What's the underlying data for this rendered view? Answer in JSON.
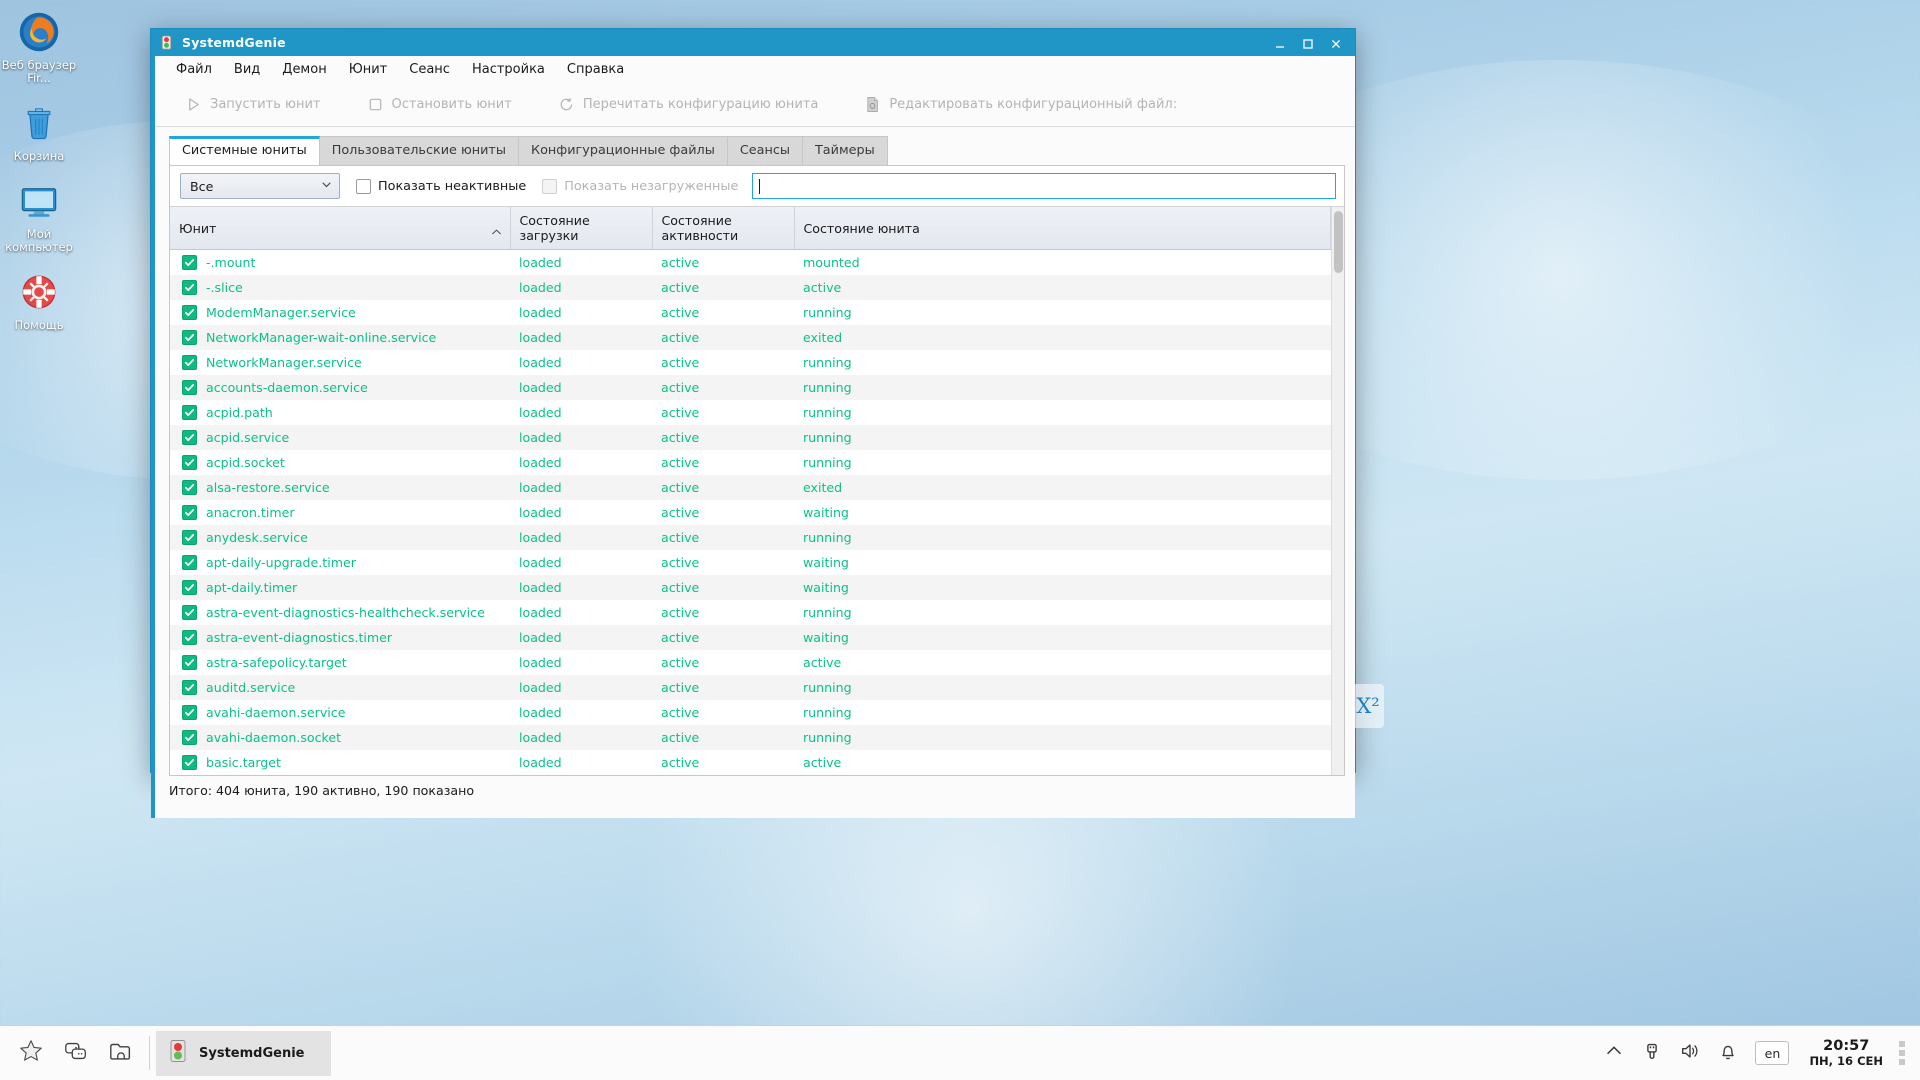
{
  "window": {
    "title": "SystemdGenie",
    "title_icon": "traffic-light-icon",
    "minimize": "minimize-button",
    "maximize": "maximize-button",
    "close": "close-button"
  },
  "menubar": {
    "items": [
      {
        "label": "Файл"
      },
      {
        "label": "Вид"
      },
      {
        "label": "Демон"
      },
      {
        "label": "Юнит"
      },
      {
        "label": "Сеанс"
      },
      {
        "label": "Настройка"
      },
      {
        "label": "Справка"
      }
    ]
  },
  "toolbar": {
    "buttons": [
      {
        "label": "Запустить юнит",
        "icon": "play-icon",
        "enabled": false
      },
      {
        "label": "Остановить юнит",
        "icon": "stop-icon",
        "enabled": false
      },
      {
        "label": "Перечитать конфигурацию юнита",
        "icon": "reload-icon",
        "enabled": false
      },
      {
        "label": "Редактировать конфигурационный файл:",
        "icon": "document-edit-icon",
        "enabled": false
      }
    ]
  },
  "tabs": [
    {
      "label": "Системные юниты",
      "active": true
    },
    {
      "label": "Пользовательские юниты",
      "active": false
    },
    {
      "label": "Конфигурационные файлы",
      "active": false
    },
    {
      "label": "Сеансы",
      "active": false
    },
    {
      "label": "Таймеры",
      "active": false
    }
  ],
  "filterbar": {
    "combo_value": "Все",
    "combo_options": [
      "Все"
    ],
    "show_inactive_label": "Показать неактивные",
    "show_inactive_checked": false,
    "show_unloaded_label": "Показать незагруженные",
    "show_unloaded_checked": false,
    "show_unloaded_enabled": false,
    "search_value": "",
    "search_placeholder": ""
  },
  "table": {
    "columns": [
      "Юнит",
      "Состояние загрузки",
      "Состояние активности",
      "Состояние юнита"
    ],
    "sort_column": 0,
    "sort_direction": "asc",
    "rows": [
      {
        "unit": "-.mount",
        "load": "loaded",
        "active": "active",
        "sub": "mounted",
        "checked": true
      },
      {
        "unit": "-.slice",
        "load": "loaded",
        "active": "active",
        "sub": "active",
        "checked": true
      },
      {
        "unit": "ModemManager.service",
        "load": "loaded",
        "active": "active",
        "sub": "running",
        "checked": true
      },
      {
        "unit": "NetworkManager-wait-online.service",
        "load": "loaded",
        "active": "active",
        "sub": "exited",
        "checked": true
      },
      {
        "unit": "NetworkManager.service",
        "load": "loaded",
        "active": "active",
        "sub": "running",
        "checked": true
      },
      {
        "unit": "accounts-daemon.service",
        "load": "loaded",
        "active": "active",
        "sub": "running",
        "checked": true
      },
      {
        "unit": "acpid.path",
        "load": "loaded",
        "active": "active",
        "sub": "running",
        "checked": true
      },
      {
        "unit": "acpid.service",
        "load": "loaded",
        "active": "active",
        "sub": "running",
        "checked": true
      },
      {
        "unit": "acpid.socket",
        "load": "loaded",
        "active": "active",
        "sub": "running",
        "checked": true
      },
      {
        "unit": "alsa-restore.service",
        "load": "loaded",
        "active": "active",
        "sub": "exited",
        "checked": true
      },
      {
        "unit": "anacron.timer",
        "load": "loaded",
        "active": "active",
        "sub": "waiting",
        "checked": true
      },
      {
        "unit": "anydesk.service",
        "load": "loaded",
        "active": "active",
        "sub": "running",
        "checked": true
      },
      {
        "unit": "apt-daily-upgrade.timer",
        "load": "loaded",
        "active": "active",
        "sub": "waiting",
        "checked": true
      },
      {
        "unit": "apt-daily.timer",
        "load": "loaded",
        "active": "active",
        "sub": "waiting",
        "checked": true
      },
      {
        "unit": "astra-event-diagnostics-healthcheck.service",
        "load": "loaded",
        "active": "active",
        "sub": "running",
        "checked": true
      },
      {
        "unit": "astra-event-diagnostics.timer",
        "load": "loaded",
        "active": "active",
        "sub": "waiting",
        "checked": true
      },
      {
        "unit": "astra-safepolicy.target",
        "load": "loaded",
        "active": "active",
        "sub": "active",
        "checked": true
      },
      {
        "unit": "auditd.service",
        "load": "loaded",
        "active": "active",
        "sub": "running",
        "checked": true
      },
      {
        "unit": "avahi-daemon.service",
        "load": "loaded",
        "active": "active",
        "sub": "running",
        "checked": true
      },
      {
        "unit": "avahi-daemon.socket",
        "load": "loaded",
        "active": "active",
        "sub": "running",
        "checked": true
      },
      {
        "unit": "basic.target",
        "load": "loaded",
        "active": "active",
        "sub": "active",
        "checked": true
      }
    ]
  },
  "statusbar": {
    "text": "Итого: 404 юнита, 190 активно, 190 показано"
  },
  "desktop": {
    "icons": [
      {
        "label": "Веб браузер Fir...",
        "icon": "firefox-icon"
      },
      {
        "label": "Корзина",
        "icon": "trash-icon"
      },
      {
        "label": "Мой компьютер",
        "icon": "computer-icon"
      },
      {
        "label": "Помощь",
        "icon": "lifebuoy-help-icon"
      }
    ],
    "widget_label": "X²"
  },
  "taskbar": {
    "launchers": [
      {
        "icon": "star-menu-icon"
      },
      {
        "icon": "show-desktop-icon"
      },
      {
        "icon": "file-manager-icon"
      }
    ],
    "task": {
      "label": "SystemdGenie",
      "icon": "traffic-light-icon"
    },
    "tray": [
      {
        "icon": "chevron-up-icon"
      },
      {
        "icon": "usb-icon"
      },
      {
        "icon": "volume-icon"
      },
      {
        "icon": "bell-icon"
      }
    ],
    "language": "en",
    "clock_time": "20:57",
    "clock_date": "ПН, 16 СЕН"
  },
  "colors": {
    "accent": "#1f96c6",
    "tab_accent": "#22a7dd",
    "status_green": "#0bc18a",
    "checkbox_green": "#10b981"
  }
}
